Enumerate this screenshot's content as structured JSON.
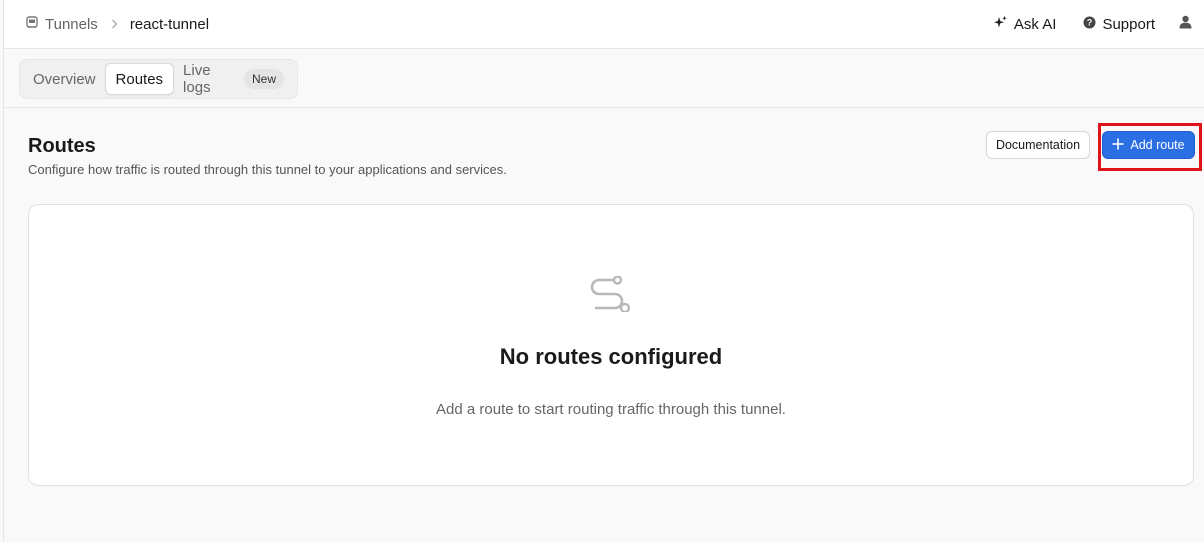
{
  "breadcrumb": {
    "parent": "Tunnels",
    "current": "react-tunnel"
  },
  "header": {
    "ask_ai": "Ask AI",
    "support": "Support"
  },
  "tabs": [
    {
      "label": "Overview",
      "active": false
    },
    {
      "label": "Routes",
      "active": true
    },
    {
      "label": "Live logs",
      "active": false,
      "badge": "New"
    }
  ],
  "section": {
    "title": "Routes",
    "description": "Configure how traffic is routed through this tunnel to your applications and services.",
    "documentation_label": "Documentation",
    "add_route_label": "Add route"
  },
  "empty_state": {
    "title": "No routes configured",
    "description": "Add a route to start routing traffic through this tunnel."
  },
  "colors": {
    "primary": "#2c6fe5",
    "highlight": "#e0131b",
    "background": "#f9f9f9"
  },
  "icons": [
    "tunnel-icon",
    "chevron-right-icon",
    "sparkle-icon",
    "help-circle-icon",
    "user-icon",
    "plus-icon",
    "route-icon"
  ]
}
